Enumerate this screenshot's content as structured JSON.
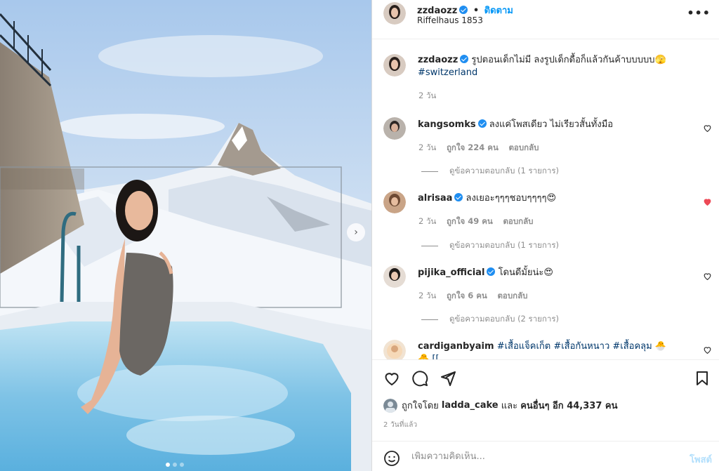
{
  "header": {
    "username": "zzdaozz",
    "separator": "•",
    "follow_label": "ติดตาม",
    "location": "Riffelhaus 1853",
    "more_label": "•••"
  },
  "caption": {
    "username": "zzdaozz",
    "text": "รูปตอนเด็กไม่มี ลงรูปเด็กดื้อก็แล้วกันค้าบบบบบ",
    "emoji": "🫣",
    "hashtag": "#switzerland",
    "time": "2 วัน"
  },
  "comments": [
    {
      "username": "kangsomks",
      "text": "ลงแค่โพสเดียว ไม่เรียวสั้นทั้งมือ",
      "time": "2 วัน",
      "likes": "ถูกใจ 224 คน",
      "reply_label": "ตอบกลับ",
      "view_replies": "ดูข้อความตอบกลับ (1 รายการ)",
      "liked": false
    },
    {
      "username": "alrisaa",
      "text": "ลงเยอะๆๆๆชอบๆๆๆๆ",
      "emoji": "😍",
      "time": "2 วัน",
      "likes": "ถูกใจ 49 คน",
      "reply_label": "ตอบกลับ",
      "view_replies": "ดูข้อความตอบกลับ (1 รายการ)",
      "liked": true
    },
    {
      "username": "pijika_official",
      "text": "โดนดีมั้ยน่ะ",
      "emoji": "😍",
      "time": "2 วัน",
      "likes": "ถูกใจ 6 คน",
      "reply_label": "ตอบกลับ",
      "view_replies": "ดูข้อความตอบกลับ (2 รายการ)",
      "liked": false
    },
    {
      "username": "cardiganbyaim",
      "text": "#เสื้อแจ็คเก็ต #เสื้อกันหนาว #เสื้อคลุม 🐣 🐣 [[",
      "liked": false
    }
  ],
  "likes_summary": {
    "prefix": "ถูกใจโดย",
    "user": "ladda_cake",
    "conjunction": "และ",
    "others": "คนอื่นๆ อีก 44,337 คน"
  },
  "time_ago": "2 วันที่แล้ว",
  "add_comment": {
    "placeholder": "เพิ่มความคิดเห็น...",
    "post_label": "โพสต์"
  },
  "carousel": {
    "next_label": "›"
  },
  "colors": {
    "accent": "#0095f6",
    "verified": "#1f8ef1",
    "liked_heart": "#ed4956",
    "muted": "#8e8e8e"
  }
}
